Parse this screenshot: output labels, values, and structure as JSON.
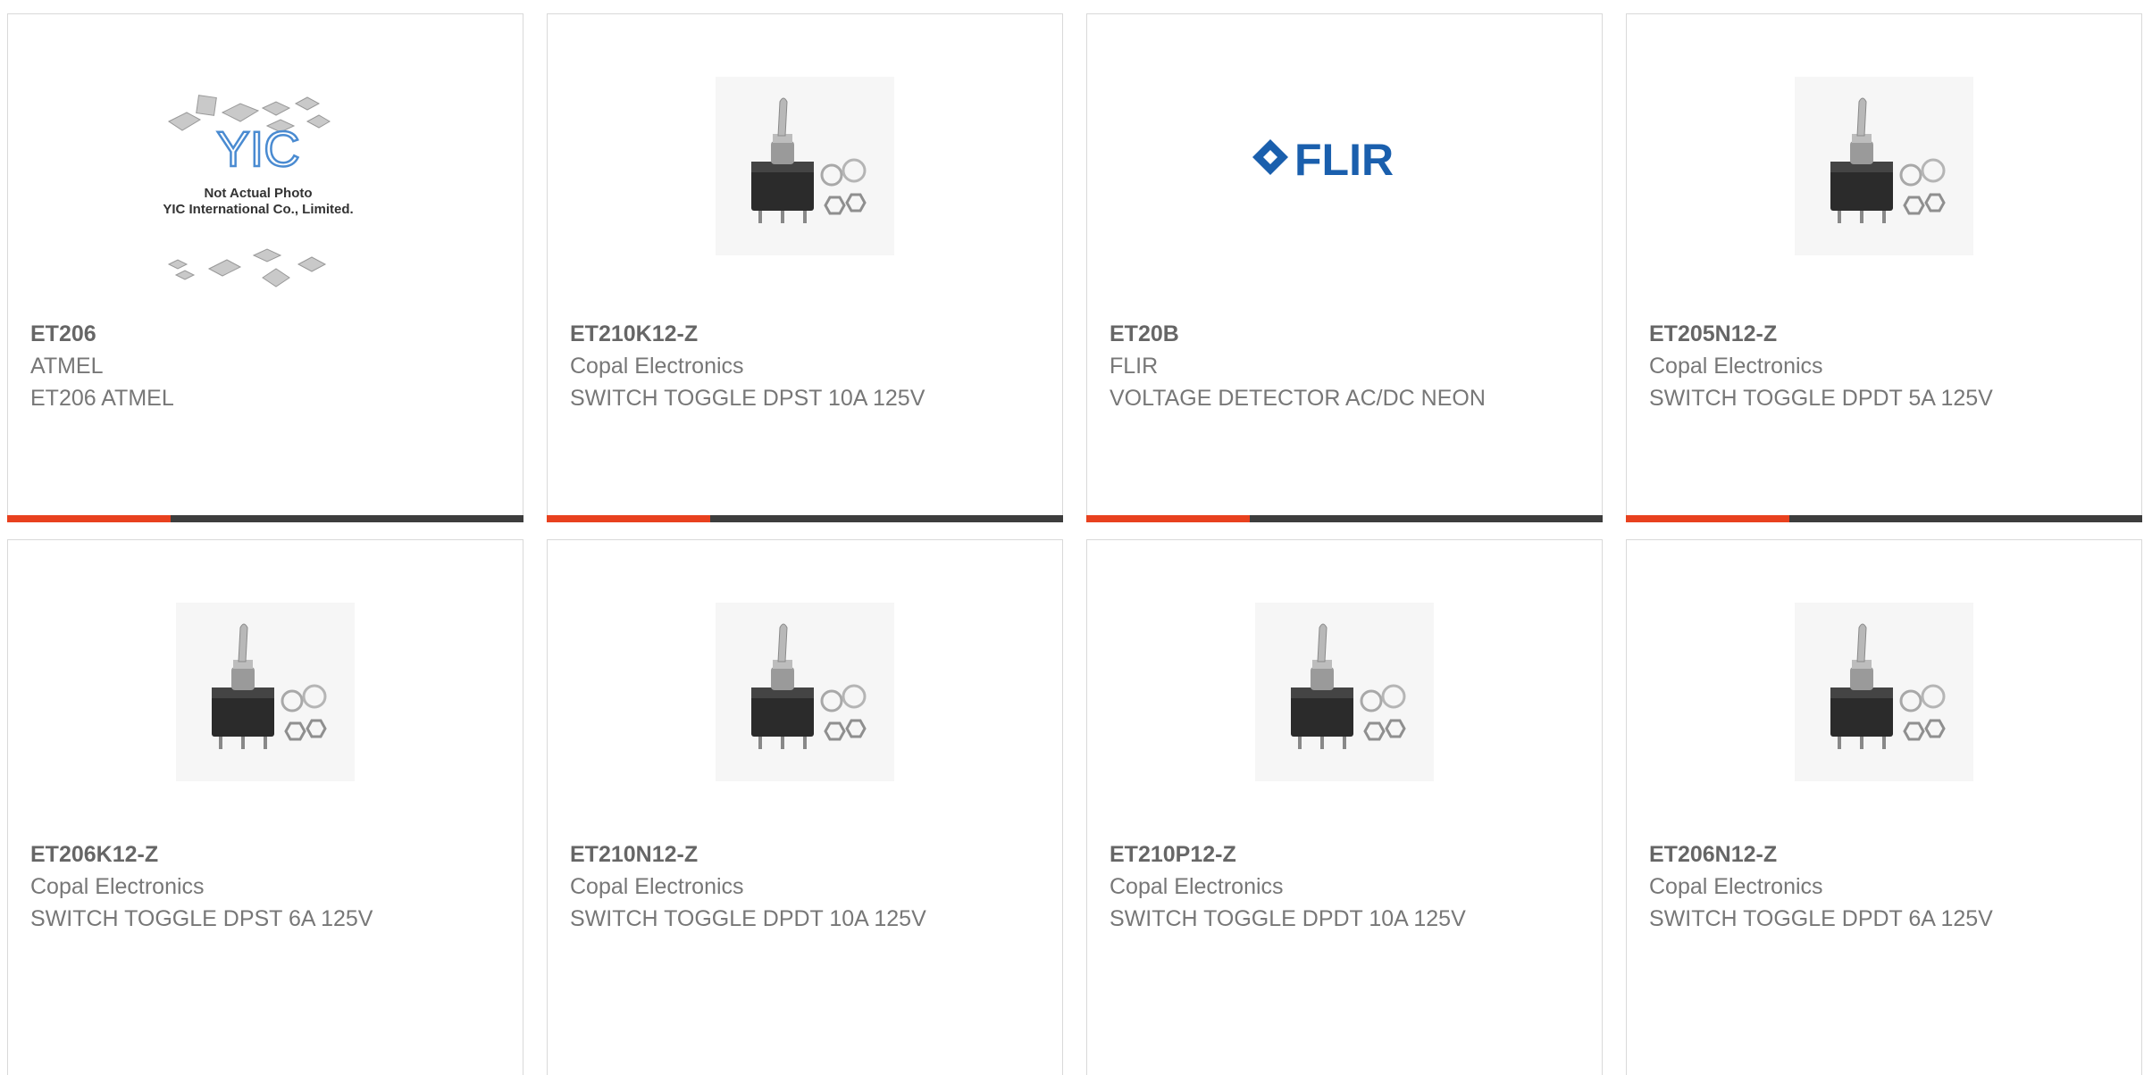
{
  "colors": {
    "accent": "#e8411e",
    "bar": "#3d3d3d",
    "text": "#777777"
  },
  "products": [
    {
      "part": "ET206",
      "manufacturer": "ATMEL",
      "description": "ET206 ATMEL",
      "image": "yic-placeholder-image",
      "placeholder_line1": "Not Actual Photo",
      "placeholder_line2": "YIC International Co., Limited.",
      "placeholder_logo": "YIC"
    },
    {
      "part": "ET210K12-Z",
      "manufacturer": "Copal Electronics",
      "description": "SWITCH TOGGLE DPST 10A 125V",
      "image": "toggle-switch-photo"
    },
    {
      "part": "ET20B",
      "manufacturer": "FLIR",
      "description": "VOLTAGE DETECTOR AC/DC NEON",
      "image": "flir-logo",
      "logo_text": "FLIR"
    },
    {
      "part": "ET205N12-Z",
      "manufacturer": "Copal Electronics",
      "description": "SWITCH TOGGLE DPDT 5A 125V",
      "image": "toggle-switch-photo"
    },
    {
      "part": "ET206K12-Z",
      "manufacturer": "Copal Electronics",
      "description": "SWITCH TOGGLE DPST 6A 125V",
      "image": "toggle-switch-photo"
    },
    {
      "part": "ET210N12-Z",
      "manufacturer": "Copal Electronics",
      "description": "SWITCH TOGGLE DPDT 10A 125V",
      "image": "toggle-switch-photo"
    },
    {
      "part": "ET210P12-Z",
      "manufacturer": "Copal Electronics",
      "description": "SWITCH TOGGLE DPDT 10A 125V",
      "image": "toggle-switch-photo"
    },
    {
      "part": "ET206N12-Z",
      "manufacturer": "Copal Electronics",
      "description": "SWITCH TOGGLE DPDT 6A 125V",
      "image": "toggle-switch-photo"
    }
  ]
}
